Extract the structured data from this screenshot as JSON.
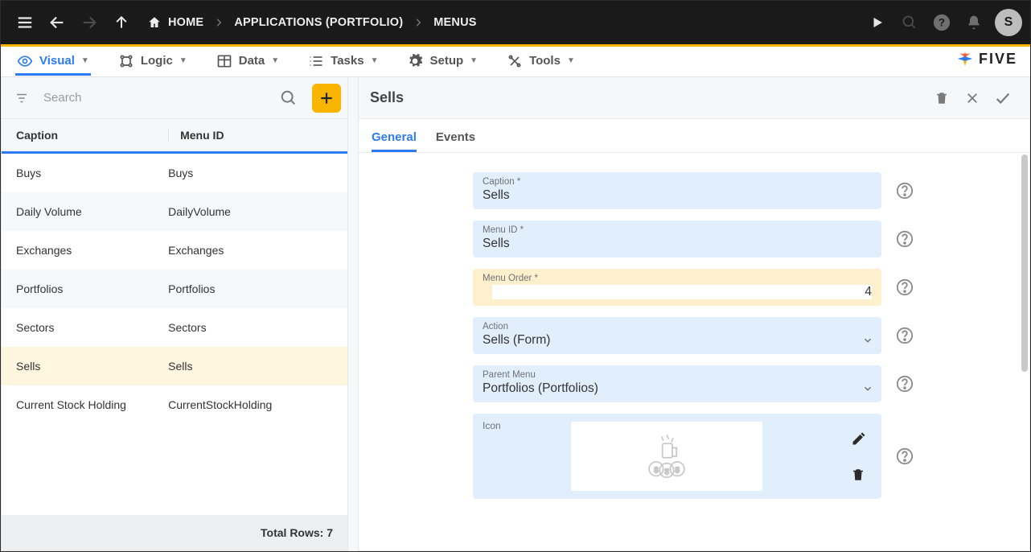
{
  "topbar": {
    "breadcrumbs": [
      "HOME",
      "APPLICATIONS (PORTFOLIO)",
      "MENUS"
    ],
    "avatar_initial": "S"
  },
  "ribbon": {
    "items": [
      {
        "label": "Visual",
        "active": true
      },
      {
        "label": "Logic"
      },
      {
        "label": "Data"
      },
      {
        "label": "Tasks"
      },
      {
        "label": "Setup"
      },
      {
        "label": "Tools"
      }
    ],
    "brand": "FIVE"
  },
  "left": {
    "search_placeholder": "Search",
    "columns": [
      "Caption",
      "Menu ID"
    ],
    "rows": [
      {
        "caption": "Buys",
        "menu_id": "Buys"
      },
      {
        "caption": "Daily Volume",
        "menu_id": "DailyVolume"
      },
      {
        "caption": "Exchanges",
        "menu_id": "Exchanges"
      },
      {
        "caption": "Portfolios",
        "menu_id": "Portfolios"
      },
      {
        "caption": "Sectors",
        "menu_id": "Sectors"
      },
      {
        "caption": "Sells",
        "menu_id": "Sells",
        "selected": true
      },
      {
        "caption": "Current Stock Holding",
        "menu_id": "CurrentStockHolding"
      }
    ],
    "footer": "Total Rows: 7"
  },
  "right": {
    "title": "Sells",
    "tabs": [
      {
        "label": "General",
        "active": true
      },
      {
        "label": "Events"
      }
    ],
    "form": {
      "caption": {
        "label": "Caption *",
        "value": "Sells"
      },
      "menu_id": {
        "label": "Menu ID *",
        "value": "Sells"
      },
      "menu_order": {
        "label": "Menu Order *",
        "value": "4"
      },
      "action": {
        "label": "Action",
        "value": "Sells (Form)"
      },
      "parent_menu": {
        "label": "Parent Menu",
        "value": "Portfolios (Portfolios)"
      },
      "icon": {
        "label": "Icon"
      }
    }
  }
}
